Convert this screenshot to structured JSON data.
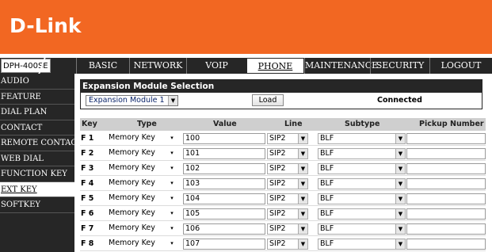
{
  "brand": {
    "logo_text": "D-Link",
    "header_color": "#f26722"
  },
  "nav": {
    "model": "DPH-400SE",
    "tabs": [
      {
        "label": "BASIC"
      },
      {
        "label": "NETWORK"
      },
      {
        "label": "VOIP"
      },
      {
        "label": "PHONE",
        "active": true
      },
      {
        "label": "MAINTENANCE"
      },
      {
        "label": "SECURITY"
      },
      {
        "label": "LOGOUT"
      }
    ]
  },
  "sidebar": {
    "items": [
      {
        "label": "AUDIO"
      },
      {
        "label": "FEATURE"
      },
      {
        "label": "DIAL PLAN"
      },
      {
        "label": "CONTACT"
      },
      {
        "label": "REMOTE CONTACT"
      },
      {
        "label": "WEB DIAL"
      },
      {
        "label": "FUNCTION KEY"
      },
      {
        "label": "EXT KEY",
        "active": true
      },
      {
        "label": "SOFTKEY"
      }
    ]
  },
  "expansion": {
    "title": "Expansion Module Selection",
    "selected_module": "Expansion Module 1",
    "load_label": "Load",
    "status": "Connected"
  },
  "table": {
    "headers": {
      "key": "Key",
      "type": "Type",
      "value": "Value",
      "line": "Line",
      "subtype": "Subtype",
      "pickup": "Pickup Number"
    },
    "rows": [
      {
        "key": "F 1",
        "type": "Memory Key",
        "value": "100",
        "line": "SIP2",
        "subtype": "BLF",
        "pickup": ""
      },
      {
        "key": "F 2",
        "type": "Memory Key",
        "value": "101",
        "line": "SIP2",
        "subtype": "BLF",
        "pickup": ""
      },
      {
        "key": "F 3",
        "type": "Memory Key",
        "value": "102",
        "line": "SIP2",
        "subtype": "BLF",
        "pickup": ""
      },
      {
        "key": "F 4",
        "type": "Memory Key",
        "value": "103",
        "line": "SIP2",
        "subtype": "BLF",
        "pickup": ""
      },
      {
        "key": "F 5",
        "type": "Memory Key",
        "value": "104",
        "line": "SIP2",
        "subtype": "BLF",
        "pickup": ""
      },
      {
        "key": "F 6",
        "type": "Memory Key",
        "value": "105",
        "line": "SIP2",
        "subtype": "BLF",
        "pickup": ""
      },
      {
        "key": "F 7",
        "type": "Memory Key",
        "value": "106",
        "line": "SIP2",
        "subtype": "BLF",
        "pickup": ""
      },
      {
        "key": "F 8",
        "type": "Memory Key",
        "value": "107",
        "line": "SIP2",
        "subtype": "BLF",
        "pickup": ""
      }
    ]
  }
}
